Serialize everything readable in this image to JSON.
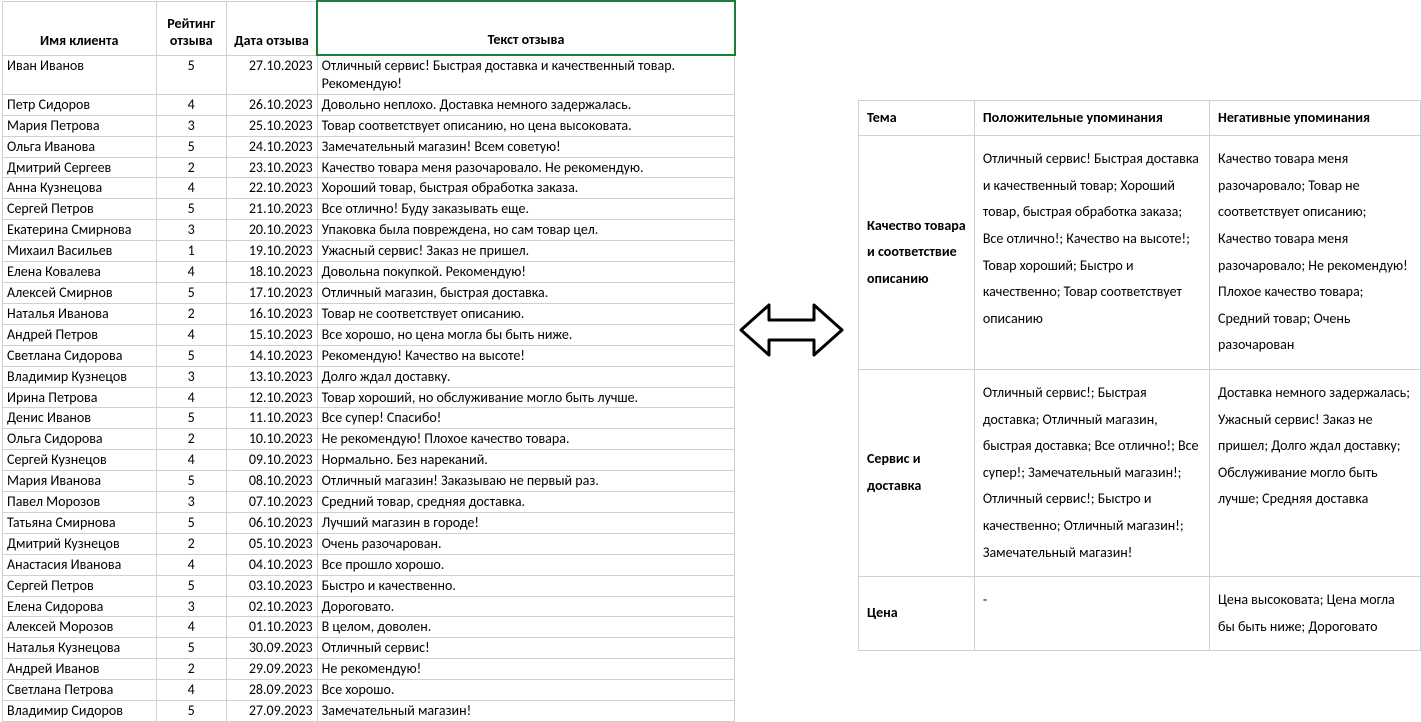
{
  "left": {
    "headers": {
      "name": "Имя клиента",
      "rate": "Рейтинг отзыва",
      "date": "Дата отзыва",
      "text": "Текст отзыва"
    },
    "rows": [
      {
        "name": "Иван Иванов",
        "rate": "5",
        "date": "27.10.2023",
        "text": "Отличный сервис! Быстрая доставка и качественный товар. Рекомендую!"
      },
      {
        "name": "Петр Сидоров",
        "rate": "4",
        "date": "26.10.2023",
        "text": "Довольно неплохо. Доставка немного задержалась."
      },
      {
        "name": "Мария Петрова",
        "rate": "3",
        "date": "25.10.2023",
        "text": "Товар соответствует описанию, но цена высоковата."
      },
      {
        "name": "Ольга Иванова",
        "rate": "5",
        "date": "24.10.2023",
        "text": "Замечательный магазин! Всем советую!"
      },
      {
        "name": "Дмитрий Сергеев",
        "rate": "2",
        "date": "23.10.2023",
        "text": "Качество товара меня разочаровало. Не рекомендую."
      },
      {
        "name": "Анна Кузнецова",
        "rate": "4",
        "date": "22.10.2023",
        "text": "Хороший товар, быстрая обработка заказа."
      },
      {
        "name": "Сергей Петров",
        "rate": "5",
        "date": "21.10.2023",
        "text": "Все отлично! Буду заказывать еще."
      },
      {
        "name": "Екатерина Смирнова",
        "rate": "3",
        "date": "20.10.2023",
        "text": "Упаковка была повреждена, но сам товар цел."
      },
      {
        "name": "Михаил Васильев",
        "rate": "1",
        "date": "19.10.2023",
        "text": "Ужасный сервис! Заказ не пришел."
      },
      {
        "name": "Елена Ковалева",
        "rate": "4",
        "date": "18.10.2023",
        "text": "Довольна покупкой. Рекомендую!"
      },
      {
        "name": "Алексей Смирнов",
        "rate": "5",
        "date": "17.10.2023",
        "text": "Отличный магазин, быстрая доставка."
      },
      {
        "name": "Наталья Иванова",
        "rate": "2",
        "date": "16.10.2023",
        "text": "Товар не соответствует описанию."
      },
      {
        "name": "Андрей Петров",
        "rate": "4",
        "date": "15.10.2023",
        "text": "Все хорошо, но цена могла бы быть ниже."
      },
      {
        "name": "Светлана Сидорова",
        "rate": "5",
        "date": "14.10.2023",
        "text": "Рекомендую! Качество на высоте!"
      },
      {
        "name": "Владимир Кузнецов",
        "rate": "3",
        "date": "13.10.2023",
        "text": "Долго ждал доставку."
      },
      {
        "name": "Ирина Петрова",
        "rate": "4",
        "date": "12.10.2023",
        "text": "Товар хороший, но обслуживание могло быть лучше."
      },
      {
        "name": "Денис Иванов",
        "rate": "5",
        "date": "11.10.2023",
        "text": "Все супер! Спасибо!"
      },
      {
        "name": "Ольга Сидорова",
        "rate": "2",
        "date": "10.10.2023",
        "text": "Не рекомендую! Плохое качество товара."
      },
      {
        "name": "Сергей Кузнецов",
        "rate": "4",
        "date": "09.10.2023",
        "text": "Нормально. Без нареканий."
      },
      {
        "name": "Мария Иванова",
        "rate": "5",
        "date": "08.10.2023",
        "text": "Отличный магазин! Заказываю не первый раз."
      },
      {
        "name": "Павел Морозов",
        "rate": "3",
        "date": "07.10.2023",
        "text": "Средний товар, средняя доставка."
      },
      {
        "name": "Татьяна Смирнова",
        "rate": "5",
        "date": "06.10.2023",
        "text": "Лучший магазин в городе!"
      },
      {
        "name": "Дмитрий Кузнецов",
        "rate": "2",
        "date": "05.10.2023",
        "text": "Очень разочарован."
      },
      {
        "name": "Анастасия Иванова",
        "rate": "4",
        "date": "04.10.2023",
        "text": "Все прошло хорошо."
      },
      {
        "name": "Сергей Петров",
        "rate": "5",
        "date": "03.10.2023",
        "text": "Быстро и качественно."
      },
      {
        "name": "Елена Сидорова",
        "rate": "3",
        "date": "02.10.2023",
        "text": "Дороговато."
      },
      {
        "name": "Алексей Морозов",
        "rate": "4",
        "date": "01.10.2023",
        "text": "В целом, доволен."
      },
      {
        "name": "Наталья Кузнецова",
        "rate": "5",
        "date": "30.09.2023",
        "text": "Отличный сервис!"
      },
      {
        "name": "Андрей Иванов",
        "rate": "2",
        "date": "29.09.2023",
        "text": "Не рекомендую!"
      },
      {
        "name": "Светлана Петрова",
        "rate": "4",
        "date": "28.09.2023",
        "text": "Все хорошо."
      },
      {
        "name": "Владимир Сидоров",
        "rate": "5",
        "date": "27.09.2023",
        "text": "Замечательный магазин!"
      }
    ]
  },
  "right": {
    "headers": {
      "theme": "Тема",
      "pos": "Положительные упоминания",
      "neg": "Негативные упоминания"
    },
    "rows": [
      {
        "theme": "Качество товара и соответствие описанию",
        "pos": "Отличный сервис! Быстрая доставка и качественный товар; Хороший товар, быстрая обработка заказа; Все отлично!; Качество на высоте!; Товар хороший; Быстро и качественно; Товар соответствует описанию",
        "neg": "Качество товара меня разочаровало; Товар не соответствует описанию; Качество товара меня разочаровало; Не рекомендую! Плохое качество товара; Средний товар; Очень разочарован"
      },
      {
        "theme": "Сервис и доставка",
        "pos": "Отличный сервис!; Быстрая доставка; Отличный магазин, быстрая доставка; Все отлично!; Все супер!; Замечательный магазин!; Отличный сервис!; Быстро и качественно; Отличный магазин!; Замечательный магазин!",
        "neg": "Доставка немного задержалась; Ужасный сервис! Заказ не пришел; Долго ждал доставку; Обслуживание могло быть лучше; Средняя доставка"
      },
      {
        "theme": "Цена",
        "pos": "-",
        "neg": "Цена высоковата; Цена могла бы быть ниже; Дороговато"
      }
    ]
  }
}
